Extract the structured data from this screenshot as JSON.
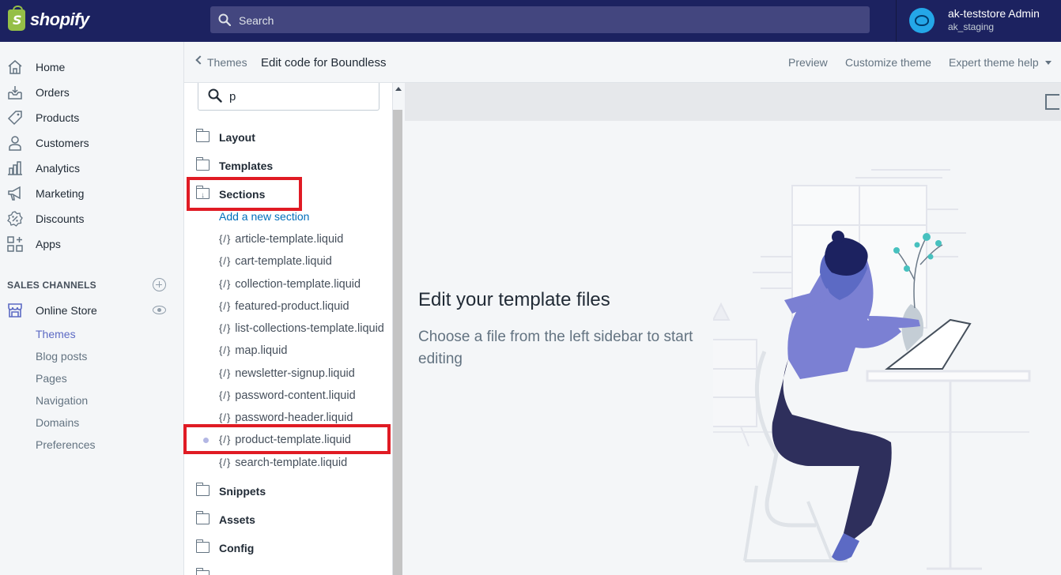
{
  "app": {
    "brand": "shopify",
    "search_placeholder": "Search",
    "account_name": "ak-teststore Admin",
    "account_store": "ak_staging"
  },
  "nav": {
    "items": [
      {
        "label": "Home",
        "icon": "home-icon"
      },
      {
        "label": "Orders",
        "icon": "orders-icon"
      },
      {
        "label": "Products",
        "icon": "tag-icon"
      },
      {
        "label": "Customers",
        "icon": "person-icon"
      },
      {
        "label": "Analytics",
        "icon": "bar-chart-icon"
      },
      {
        "label": "Marketing",
        "icon": "megaphone-icon"
      },
      {
        "label": "Discounts",
        "icon": "discount-icon"
      },
      {
        "label": "Apps",
        "icon": "apps-icon"
      }
    ],
    "channels_title": "SALES CHANNELS",
    "online_store": "Online Store",
    "sub_items": [
      "Themes",
      "Blog posts",
      "Pages",
      "Navigation",
      "Domains",
      "Preferences"
    ],
    "active_sub": "Themes"
  },
  "header": {
    "back_label": "Themes",
    "edit_prefix": "Edit code for",
    "theme_name": "Boundless",
    "preview": "Preview",
    "customize": "Customize theme",
    "help": "Expert theme help"
  },
  "files": {
    "filter_value": "p",
    "folders_top": [
      "Layout",
      "Templates"
    ],
    "open_folder": "Sections",
    "add_link": "Add a new section",
    "braces": "{/}",
    "section_files": [
      "article-template.liquid",
      "cart-template.liquid",
      "collection-template.liquid",
      "featured-product.liquid",
      "list-collections-template.liquid",
      "map.liquid",
      "newsletter-signup.liquid",
      "password-content.liquid",
      "password-header.liquid",
      "product-template.liquid",
      "search-template.liquid"
    ],
    "modified_file": "product-template.liquid",
    "folders_bottom": [
      "Snippets",
      "Assets",
      "Config"
    ]
  },
  "main": {
    "title": "Edit your template files",
    "text": "Choose a file from the left sidebar to start editing"
  },
  "colors": {
    "topbar": "#1c2260",
    "accent": "#5c6ac4",
    "link": "#006fbb",
    "callout": "#e01b24"
  }
}
